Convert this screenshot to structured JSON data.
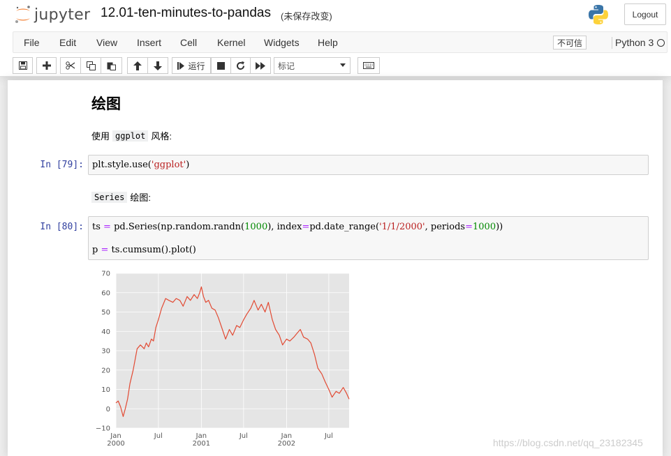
{
  "header": {
    "logo_text": "jupyter",
    "notebook_name": "12.01-ten-minutes-to-pandas",
    "save_status": "(未保存改变)",
    "logout_label": "Logout"
  },
  "menubar": {
    "items": [
      "File",
      "Edit",
      "View",
      "Insert",
      "Cell",
      "Kernel",
      "Widgets",
      "Help"
    ],
    "trust_label": "不可信",
    "kernel_name": "Python 3"
  },
  "toolbar": {
    "run_label": "运行",
    "cell_type": "标记"
  },
  "cells": {
    "heading": "绘图",
    "p1_prefix": "使用",
    "p1_code": "ggplot",
    "p1_suffix": "风格:",
    "in79_prompt": "In [79]:",
    "p2_code": "Series",
    "p2_suffix": "绘图:",
    "in80_prompt": "In [80]:"
  },
  "chart_data": {
    "type": "line",
    "x_ticks": [
      "Jan\n2000",
      "Jul",
      "Jan\n2001",
      "Jul",
      "Jan\n2002",
      "Jul"
    ],
    "yticks": [
      -10,
      0,
      10,
      20,
      30,
      40,
      50,
      60,
      70
    ],
    "ylim": [
      -10,
      70
    ],
    "grid": true,
    "color": "#e24a33",
    "background": "#e5e5e5",
    "x": [
      "2000-01-01",
      "2000-01-11",
      "2000-01-21",
      "2000-02-01",
      "2000-02-10",
      "2000-02-20",
      "2000-03-01",
      "2000-03-15",
      "2000-04-01",
      "2000-04-15",
      "2000-05-01",
      "2000-05-10",
      "2000-05-20",
      "2000-06-01",
      "2000-06-10",
      "2000-06-20",
      "2000-07-01",
      "2000-07-15",
      "2000-08-01",
      "2000-08-15",
      "2000-09-01",
      "2000-09-15",
      "2000-10-01",
      "2000-10-15",
      "2000-11-01",
      "2000-11-15",
      "2000-12-01",
      "2000-12-15",
      "2000-12-25",
      "2001-01-01",
      "2001-01-10",
      "2001-01-20",
      "2001-02-01",
      "2001-02-15",
      "2001-03-01",
      "2001-03-15",
      "2001-04-01",
      "2001-04-15",
      "2001-05-01",
      "2001-05-15",
      "2001-06-01",
      "2001-06-15",
      "2001-07-01",
      "2001-07-15",
      "2001-08-01",
      "2001-08-15",
      "2001-09-01",
      "2001-09-15",
      "2001-10-01",
      "2001-10-15",
      "2001-11-01",
      "2001-11-15",
      "2001-12-01",
      "2001-12-15",
      "2002-01-01",
      "2002-01-15",
      "2002-02-01",
      "2002-02-15",
      "2002-03-01",
      "2002-03-15",
      "2002-04-01",
      "2002-04-15",
      "2002-05-01",
      "2002-05-15",
      "2002-06-01",
      "2002-06-15",
      "2002-07-01",
      "2002-07-15",
      "2002-08-01",
      "2002-08-15",
      "2002-09-01",
      "2002-09-15",
      "2002-09-26"
    ],
    "y": [
      3,
      4,
      1,
      -4,
      0,
      5,
      13,
      20,
      31,
      33,
      31,
      34,
      32,
      36,
      35,
      42,
      46,
      52,
      57,
      56,
      55,
      57,
      56,
      53,
      58,
      56,
      59,
      57,
      60,
      63,
      58,
      55,
      56,
      52,
      51,
      47,
      41,
      36,
      41,
      38,
      43,
      42,
      46,
      49,
      52,
      56,
      51,
      54,
      50,
      55,
      46,
      41,
      38,
      33,
      36,
      35,
      37,
      39,
      41,
      37,
      36,
      34,
      28,
      21,
      18,
      14,
      10,
      6,
      9,
      8,
      11,
      8,
      5
    ],
    "series": [
      {
        "values_ref": "y"
      }
    ]
  }
}
